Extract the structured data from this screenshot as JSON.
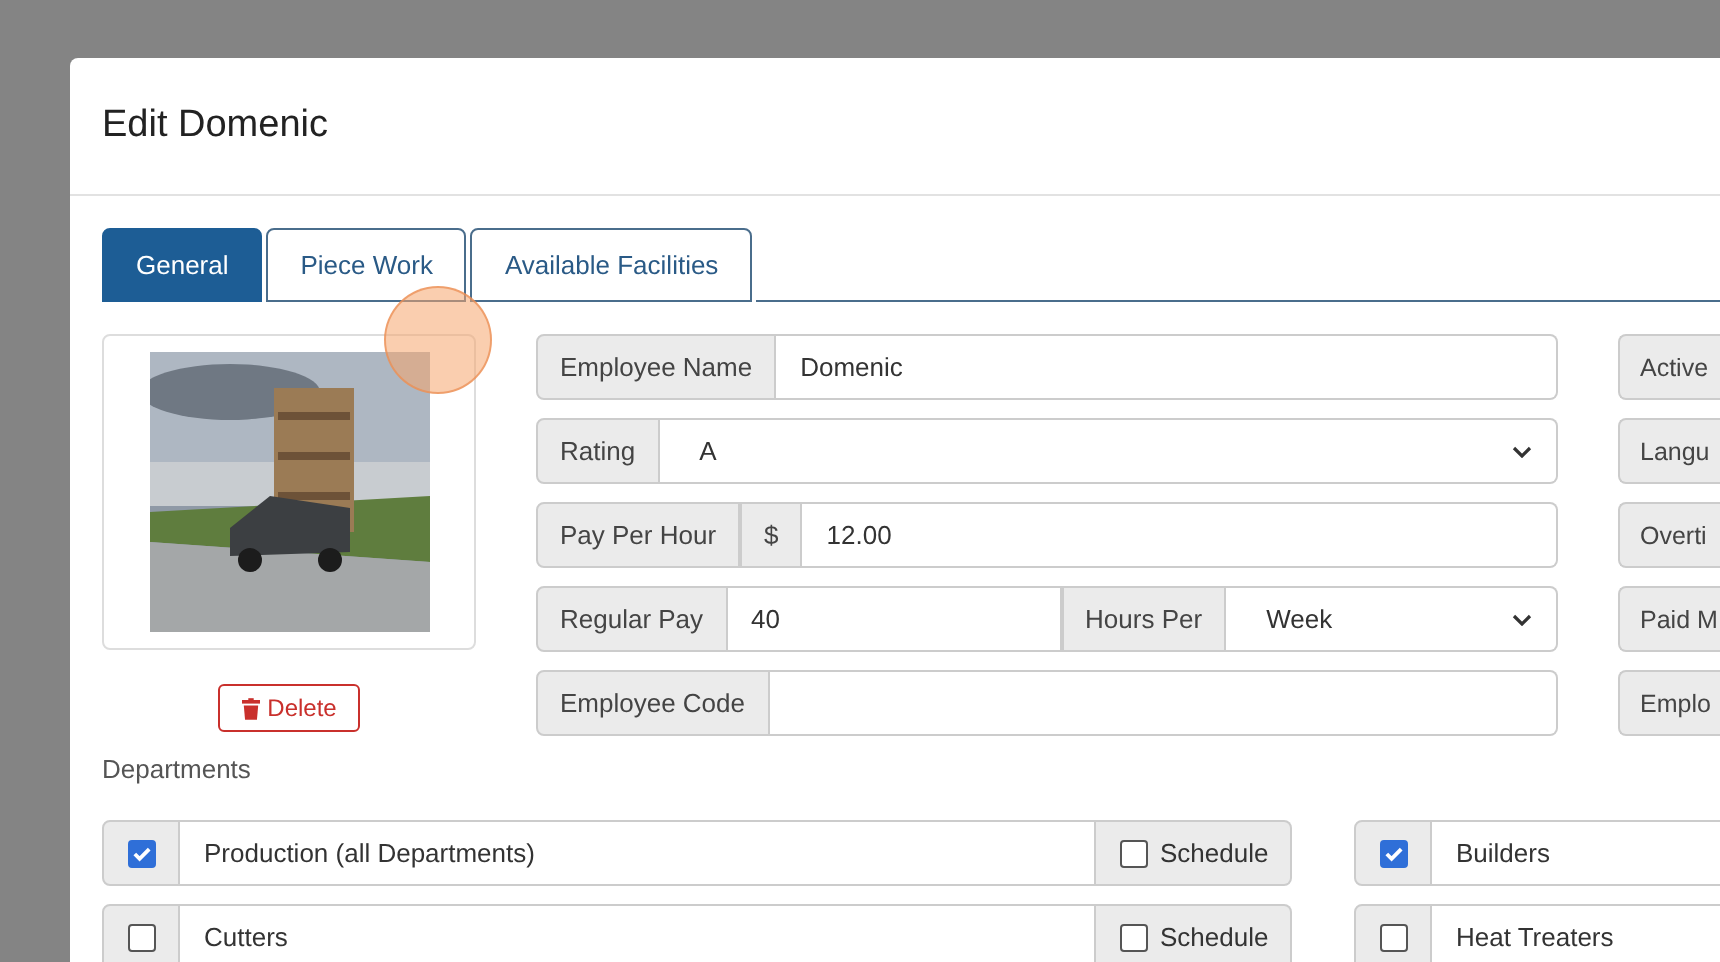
{
  "dialog": {
    "title": "Edit Domenic"
  },
  "tabs": [
    {
      "label": "General",
      "selected": true
    },
    {
      "label": "Piece Work",
      "selected": false
    },
    {
      "label": "Available Facilities",
      "selected": false
    }
  ],
  "photo": {
    "kind": "picture",
    "delete_label": "Delete"
  },
  "fields": [
    {
      "kind": "text",
      "label": "Employee Name",
      "value": "Domenic"
    },
    {
      "kind": "select",
      "label": "Rating",
      "value": "A"
    },
    {
      "kind": "money",
      "label": "Pay Per Hour",
      "prefix": "$",
      "value": "12.00"
    },
    {
      "kind": "split",
      "label": "Regular Pay",
      "value": "40",
      "label_2": "Hours Per",
      "value_2": "Week"
    },
    {
      "kind": "text",
      "label": "Employee Code"
    }
  ],
  "side_fields": [
    "Active",
    "Langu",
    "Overti",
    "Paid M",
    "Emplo"
  ],
  "departments": {
    "heading": "Departments",
    "rows": [
      {
        "left": {
          "name": "Production (all Departments)",
          "checked": true,
          "schedule": "Schedule",
          "schedule_checked": false
        },
        "right": {
          "name": "Builders",
          "checked": true
        }
      },
      {
        "left": {
          "name": "Cutters",
          "checked": false,
          "schedule": "Schedule",
          "schedule_checked": false
        },
        "right": {
          "name": "Heat Treaters",
          "checked": false
        }
      }
    ]
  }
}
